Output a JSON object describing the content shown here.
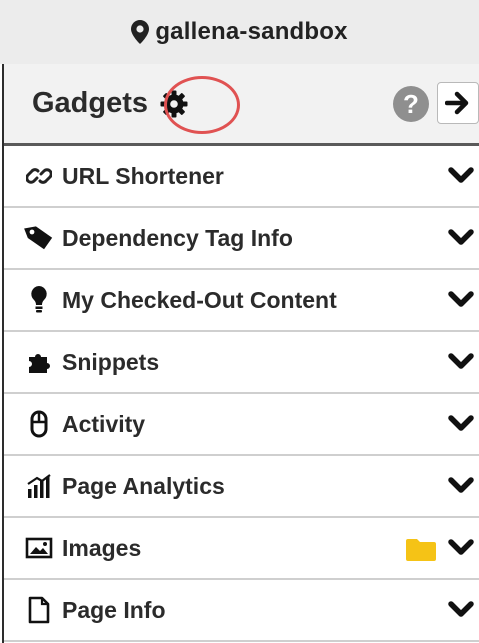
{
  "site": {
    "name": "gallena-sandbox",
    "icon": "map-marker-icon"
  },
  "panel": {
    "title": "Gadgets",
    "settings_icon": "gear-icon",
    "help_icon_text": "?",
    "collapse_icon": "arrow-right-icon",
    "highlight_color": "#e05252"
  },
  "gadgets": [
    {
      "label": "URL Shortener",
      "icon": "link-icon"
    },
    {
      "label": "Dependency Tag Info",
      "icon": "tag-icon"
    },
    {
      "label": "My Checked-Out Content",
      "icon": "lightbulb-icon"
    },
    {
      "label": "Snippets",
      "icon": "puzzle-icon"
    },
    {
      "label": "Activity",
      "icon": "mouse-icon"
    },
    {
      "label": "Page Analytics",
      "icon": "bar-chart-icon"
    },
    {
      "label": "Images",
      "icon": "image-icon",
      "extra_icon": "folder-icon"
    },
    {
      "label": "Page Info",
      "icon": "file-icon"
    }
  ],
  "colors": {
    "folder": "#f5c316",
    "text": "#2b2b2b",
    "header_bg": "#f2f2f2"
  }
}
